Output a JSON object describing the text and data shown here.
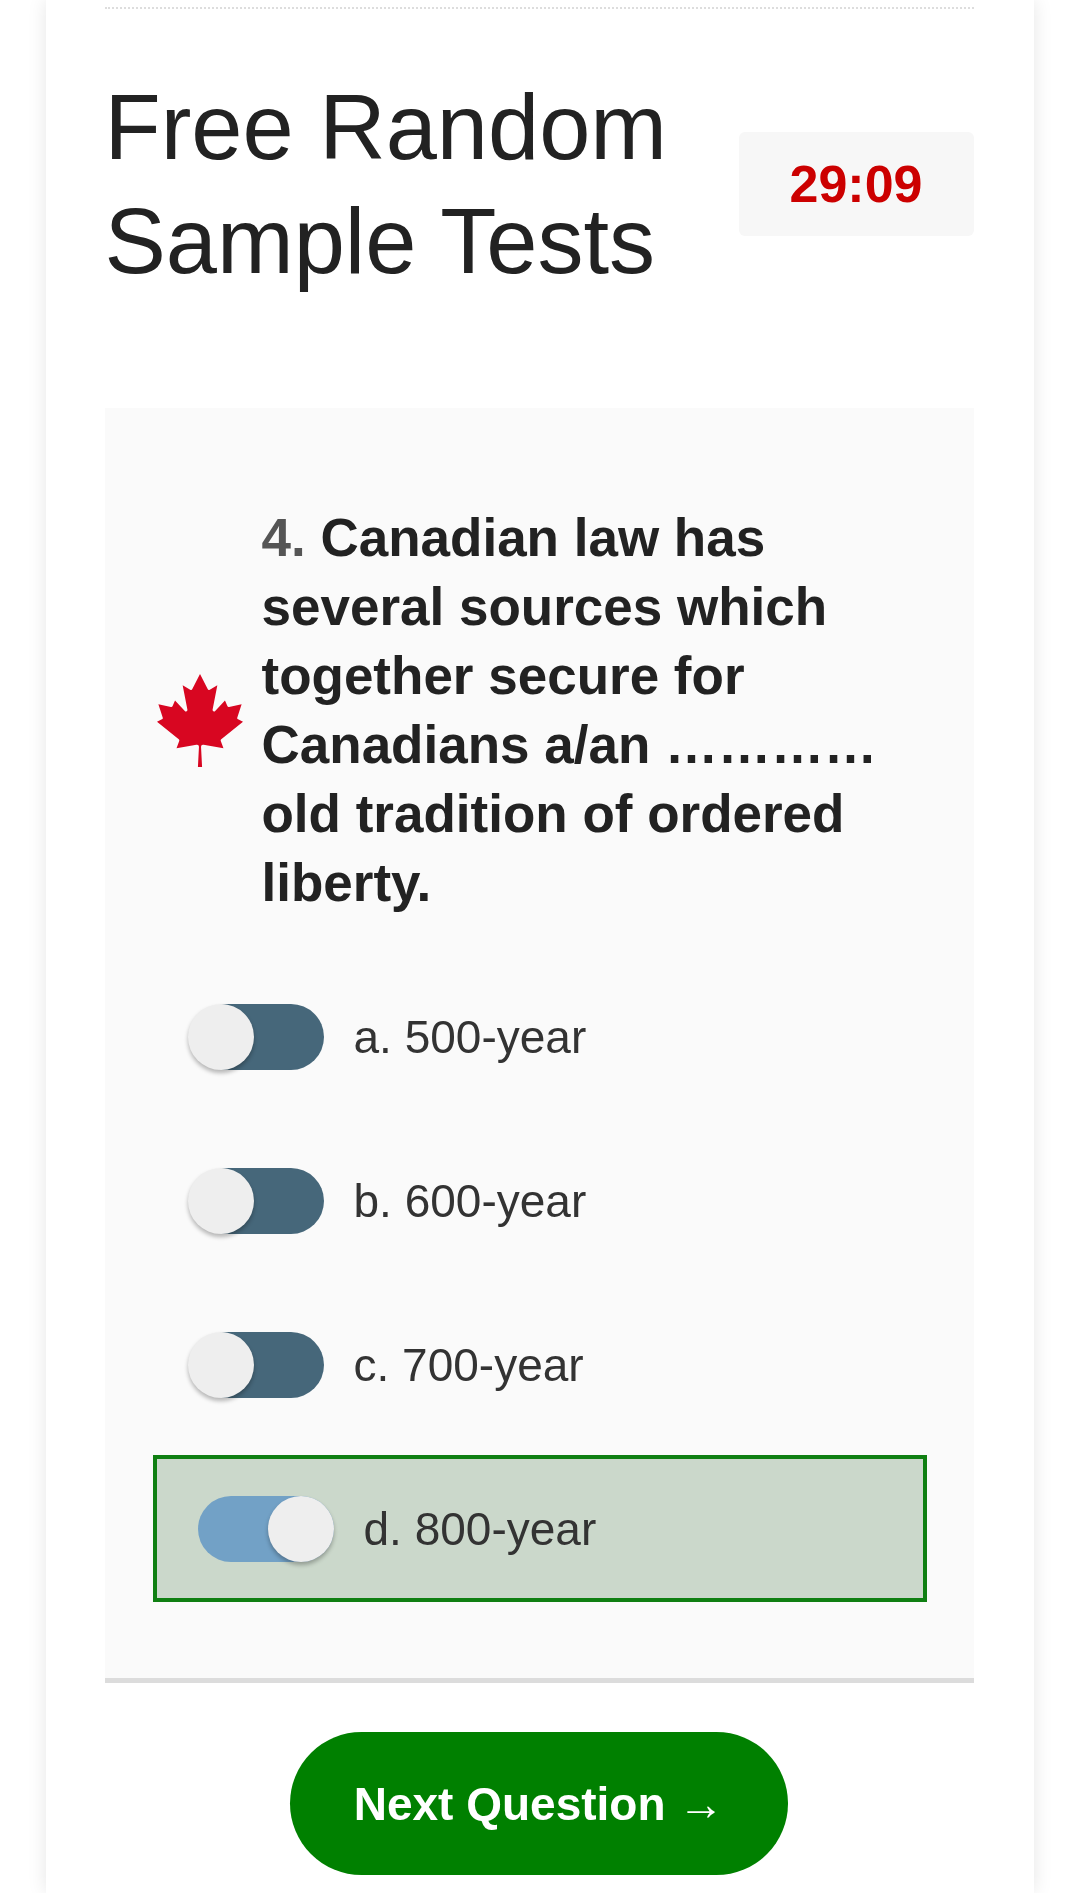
{
  "header": {
    "title": "Free Random Sample Tests",
    "timer": "29:09"
  },
  "question": {
    "number": "4.",
    "text": "Canadian law has several sources which together secure for Canadians a/an ………… old tradition of ordered liberty."
  },
  "options": [
    {
      "label": "a. 500-year",
      "selected": false
    },
    {
      "label": "b. 600-year",
      "selected": false
    },
    {
      "label": "c. 700-year",
      "selected": false
    },
    {
      "label": "d. 800-year",
      "selected": true
    }
  ],
  "next_button": {
    "label": "Next Question →"
  }
}
